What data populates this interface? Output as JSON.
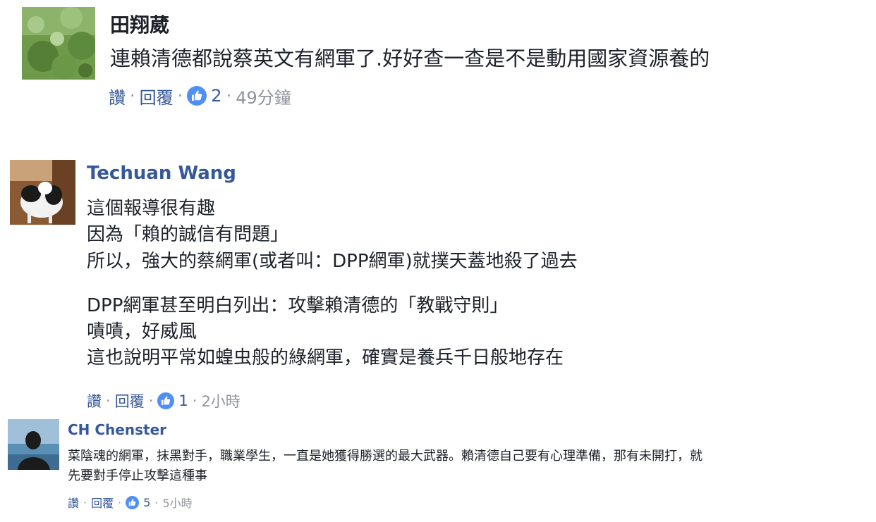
{
  "comments": [
    {
      "author": "田翔葳",
      "lines": [
        "連賴清德都說蔡英文有網軍了.好好查一查是不是動用國家資源養的"
      ],
      "actions": {
        "like": "讚",
        "reply": "回覆",
        "sep": "·",
        "likes": "2",
        "time": "49分鐘"
      }
    },
    {
      "author": "Techuan Wang",
      "lines": [
        "這個報導很有趣",
        "因為「賴的誠信有問題」",
        "所以，強大的蔡網軍(或者叫：DPP網軍)就撲天蓋地殺了過去",
        "",
        "DPP網軍甚至明白列出：攻擊賴清德的「教戰守則」",
        "嘖嘖，好威風",
        "這也說明平常如蝗虫般的綠網軍，確實是養兵千日般地存在"
      ],
      "actions": {
        "like": "讚",
        "reply": "回覆",
        "sep": "·",
        "likes": "1",
        "time": "2小時"
      }
    },
    {
      "author": "CH Chenster",
      "lines": [
        "菜陰魂的網軍，抹黑對手，職業學生，一直是她獲得勝選的最大武器。賴清德自己要有心理準備，那有未開打，就",
        "先要對手停止攻擊這種事"
      ],
      "actions": {
        "like": "讚",
        "reply": "回覆",
        "sep": "·",
        "likes": "5",
        "time": "5小時"
      }
    }
  ],
  "colors": {
    "link": "#365899",
    "meta": "#90949c",
    "text": "#1d2129",
    "like_badge": "#4f8ff7"
  },
  "icons": {
    "like_badge": "thumbs-up-icon"
  }
}
